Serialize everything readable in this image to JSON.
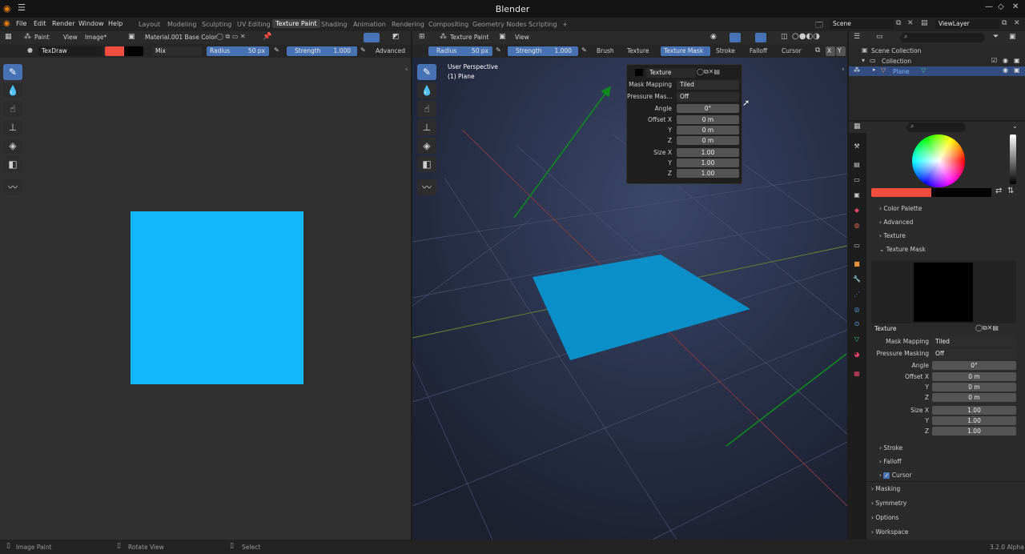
{
  "window": {
    "title": "Blender"
  },
  "menu": {
    "items": [
      "File",
      "Edit",
      "Render",
      "Window",
      "Help"
    ]
  },
  "workspaces": [
    "Layout",
    "Modeling",
    "Sculpting",
    "UV Editing",
    "Texture Paint",
    "Shading",
    "Animation",
    "Rendering",
    "Compositing",
    "Geometry Nodes",
    "Scripting",
    "+"
  ],
  "scene": {
    "scene_name": "Scene",
    "view_layer": "ViewLayer"
  },
  "image_editor": {
    "mode": "Paint",
    "view": "View",
    "image_menu": "Image*",
    "material": "Material.001 Base Color",
    "brush": "TexDraw",
    "blend": "Mix",
    "radius_label": "Radius",
    "radius_value": "50 px",
    "strength_label": "Strength",
    "strength_value": "1.000",
    "advanced": "Advanced",
    "canvas_color": "#11b9fb",
    "brush_color": "#f24e3f"
  },
  "viewport": {
    "mode": "Texture Paint",
    "view": "View",
    "radius_label": "Radius",
    "radius_value": "50 px",
    "strength_label": "Strength",
    "strength_value": "1.000",
    "menus": [
      "Brush",
      "Texture",
      "Texture Mask",
      "Stroke",
      "Falloff",
      "Cursor"
    ],
    "axes": [
      "X",
      "Y"
    ],
    "overlay_line1": "User Perspective",
    "overlay_line2": "(1) Plane",
    "popover": {
      "texture_label": "Texture",
      "mask_mapping_label": "Mask Mapping",
      "mask_mapping_value": "Tiled",
      "pressure_label": "Pressure Mas...",
      "pressure_value": "Off",
      "angle_label": "Angle",
      "angle_value": "0°",
      "offset_x_label": "Offset X",
      "offset_x": "0 m",
      "y_label": "Y",
      "offset_y": "0 m",
      "z_label": "Z",
      "offset_z": "0 m",
      "size_x_label": "Size X",
      "size_x": "1.00",
      "size_y": "1.00",
      "size_z": "1.00"
    }
  },
  "outliner": {
    "scene_collection": "Scene Collection",
    "collection": "Collection",
    "plane": "Plane"
  },
  "properties": {
    "sections": {
      "color_palette": "Color Palette",
      "advanced": "Advanced",
      "texture": "Texture",
      "texture_mask": "Texture Mask",
      "stroke": "Stroke",
      "falloff": "Falloff",
      "cursor": "Cursor",
      "masking": "Masking",
      "symmetry": "Symmetry",
      "options": "Options",
      "workspace": "Workspace"
    },
    "texture_field": "Texture",
    "mask_mapping_label": "Mask Mapping",
    "mask_mapping_value": "Tiled",
    "pressure_label": "Pressure Masking",
    "pressure_value": "Off",
    "angle_label": "Angle",
    "angle_value": "0°",
    "offset_x_label": "Offset X",
    "offset_x": "0 m",
    "y_label": "Y",
    "offset_y": "0 m",
    "z_label": "Z",
    "offset_z": "0 m",
    "size_x_label": "Size X",
    "size_x": "1.00",
    "size_y": "1.00",
    "size_z": "1.00",
    "cursor_checked": true
  },
  "statusbar": {
    "image_paint": "Image Paint",
    "rotate_view": "Rotate View",
    "select": "Select",
    "version": "3.2.0 Alpha"
  }
}
